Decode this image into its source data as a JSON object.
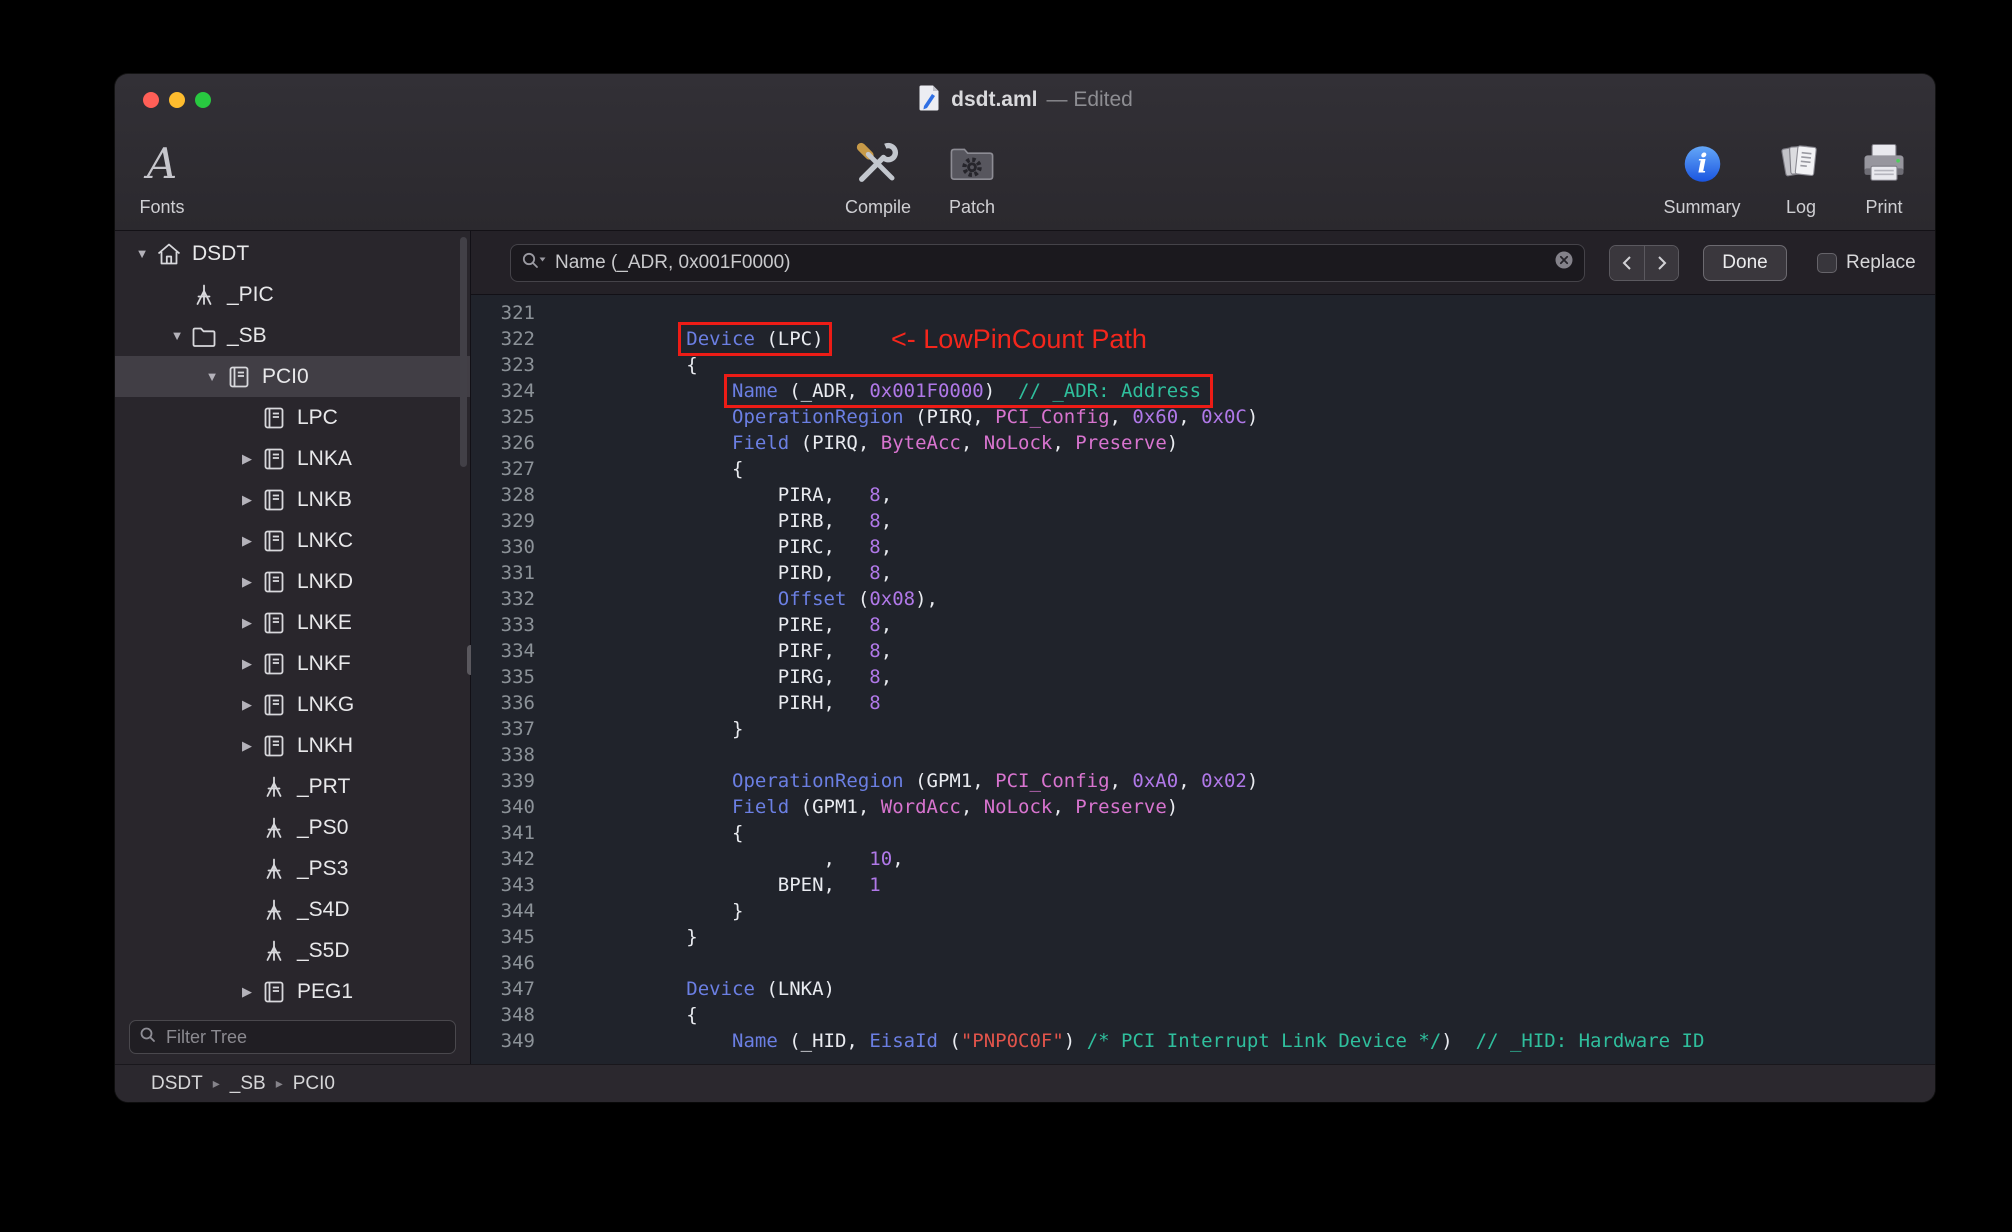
{
  "window": {
    "title_filename": "dsdt.aml",
    "title_status": "— Edited"
  },
  "toolbar": {
    "fonts_label": "Fonts",
    "compile_label": "Compile",
    "patch_label": "Patch",
    "summary_label": "Summary",
    "log_label": "Log",
    "print_label": "Print"
  },
  "sidebar": {
    "filter_placeholder": "Filter Tree",
    "tree": [
      {
        "label": "DSDT",
        "depth": 0,
        "icon": "home",
        "disclosure": "open",
        "selected": false
      },
      {
        "label": "_PIC",
        "depth": 1,
        "icon": "method",
        "disclosure": null,
        "selected": false
      },
      {
        "label": "_SB",
        "depth": 1,
        "icon": "folder",
        "disclosure": "open",
        "selected": false
      },
      {
        "label": "PCI0",
        "depth": 2,
        "icon": "device",
        "disclosure": "open",
        "selected": true
      },
      {
        "label": "LPC",
        "depth": 3,
        "icon": "device",
        "disclosure": null,
        "selected": false
      },
      {
        "label": "LNKA",
        "depth": 3,
        "icon": "device",
        "disclosure": "closed",
        "selected": false
      },
      {
        "label": "LNKB",
        "depth": 3,
        "icon": "device",
        "disclosure": "closed",
        "selected": false
      },
      {
        "label": "LNKC",
        "depth": 3,
        "icon": "device",
        "disclosure": "closed",
        "selected": false
      },
      {
        "label": "LNKD",
        "depth": 3,
        "icon": "device",
        "disclosure": "closed",
        "selected": false
      },
      {
        "label": "LNKE",
        "depth": 3,
        "icon": "device",
        "disclosure": "closed",
        "selected": false
      },
      {
        "label": "LNKF",
        "depth": 3,
        "icon": "device",
        "disclosure": "closed",
        "selected": false
      },
      {
        "label": "LNKG",
        "depth": 3,
        "icon": "device",
        "disclosure": "closed",
        "selected": false
      },
      {
        "label": "LNKH",
        "depth": 3,
        "icon": "device",
        "disclosure": "closed",
        "selected": false
      },
      {
        "label": "_PRT",
        "depth": 3,
        "icon": "method",
        "disclosure": null,
        "selected": false
      },
      {
        "label": "_PS0",
        "depth": 3,
        "icon": "method",
        "disclosure": null,
        "selected": false
      },
      {
        "label": "_PS3",
        "depth": 3,
        "icon": "method",
        "disclosure": null,
        "selected": false
      },
      {
        "label": "_S4D",
        "depth": 3,
        "icon": "method",
        "disclosure": null,
        "selected": false
      },
      {
        "label": "_S5D",
        "depth": 3,
        "icon": "method",
        "disclosure": null,
        "selected": false
      },
      {
        "label": "PEG1",
        "depth": 3,
        "icon": "device",
        "disclosure": "closed",
        "selected": false
      }
    ]
  },
  "search": {
    "query": "Name (_ADR, 0x001F0000)",
    "done_label": "Done",
    "replace_label": "Replace"
  },
  "breadcrumb": [
    "DSDT",
    "_SB",
    "PCI0"
  ],
  "annotation": {
    "arrow_text": "<- LowPinCount Path",
    "highlight_color": "#ed1c16"
  },
  "colors": {
    "syntax_keyword": "#6b7fe3",
    "syntax_number": "#b078e8",
    "syntax_predefined": "#d874cf",
    "syntax_comment": "#2fbf9d",
    "syntax_string": "#e2544b",
    "editor_background": "#20232b",
    "traffic_red": "#ff5f57",
    "traffic_yellow": "#febc2e",
    "traffic_green": "#28c840"
  },
  "editor": {
    "lines": [
      {
        "num": "321",
        "seg": []
      },
      {
        "num": "322",
        "seg": [
          [
            "t",
            "            "
          ],
          [
            "k",
            "Device"
          ],
          [
            "t",
            " (LPC)"
          ]
        ]
      },
      {
        "num": "323",
        "seg": [
          [
            "t",
            "            {"
          ]
        ]
      },
      {
        "num": "324",
        "seg": [
          [
            "t",
            "                "
          ],
          [
            "k",
            "Name"
          ],
          [
            "t",
            " (_ADR, "
          ],
          [
            "n",
            "0x001F0000"
          ],
          [
            "t",
            ")  "
          ],
          [
            "c",
            "// _ADR: Address"
          ]
        ]
      },
      {
        "num": "325",
        "seg": [
          [
            "t",
            "                "
          ],
          [
            "k",
            "OperationRegion"
          ],
          [
            "t",
            " (PIRQ, "
          ],
          [
            "p",
            "PCI_Config"
          ],
          [
            "t",
            ", "
          ],
          [
            "n",
            "0x60"
          ],
          [
            "t",
            ", "
          ],
          [
            "n",
            "0x0C"
          ],
          [
            "t",
            ")"
          ]
        ]
      },
      {
        "num": "326",
        "seg": [
          [
            "t",
            "                "
          ],
          [
            "k",
            "Field"
          ],
          [
            "t",
            " (PIRQ, "
          ],
          [
            "p",
            "ByteAcc"
          ],
          [
            "t",
            ", "
          ],
          [
            "p",
            "NoLock"
          ],
          [
            "t",
            ", "
          ],
          [
            "p",
            "Preserve"
          ],
          [
            "t",
            ")"
          ]
        ]
      },
      {
        "num": "327",
        "seg": [
          [
            "t",
            "                {"
          ]
        ]
      },
      {
        "num": "328",
        "seg": [
          [
            "t",
            "                    PIRA,   "
          ],
          [
            "n",
            "8"
          ],
          [
            "t",
            ","
          ]
        ]
      },
      {
        "num": "329",
        "seg": [
          [
            "t",
            "                    PIRB,   "
          ],
          [
            "n",
            "8"
          ],
          [
            "t",
            ","
          ]
        ]
      },
      {
        "num": "330",
        "seg": [
          [
            "t",
            "                    PIRC,   "
          ],
          [
            "n",
            "8"
          ],
          [
            "t",
            ","
          ]
        ]
      },
      {
        "num": "331",
        "seg": [
          [
            "t",
            "                    PIRD,   "
          ],
          [
            "n",
            "8"
          ],
          [
            "t",
            ","
          ]
        ]
      },
      {
        "num": "332",
        "seg": [
          [
            "t",
            "                    "
          ],
          [
            "k",
            "Offset"
          ],
          [
            "t",
            " ("
          ],
          [
            "n",
            "0x08"
          ],
          [
            "t",
            "),"
          ]
        ]
      },
      {
        "num": "333",
        "seg": [
          [
            "t",
            "                    PIRE,   "
          ],
          [
            "n",
            "8"
          ],
          [
            "t",
            ","
          ]
        ]
      },
      {
        "num": "334",
        "seg": [
          [
            "t",
            "                    PIRF,   "
          ],
          [
            "n",
            "8"
          ],
          [
            "t",
            ","
          ]
        ]
      },
      {
        "num": "335",
        "seg": [
          [
            "t",
            "                    PIRG,   "
          ],
          [
            "n",
            "8"
          ],
          [
            "t",
            ","
          ]
        ]
      },
      {
        "num": "336",
        "seg": [
          [
            "t",
            "                    PIRH,   "
          ],
          [
            "n",
            "8"
          ]
        ]
      },
      {
        "num": "337",
        "seg": [
          [
            "t",
            "                }"
          ]
        ]
      },
      {
        "num": "338",
        "seg": []
      },
      {
        "num": "339",
        "seg": [
          [
            "t",
            "                "
          ],
          [
            "k",
            "OperationRegion"
          ],
          [
            "t",
            " (GPM1, "
          ],
          [
            "p",
            "PCI_Config"
          ],
          [
            "t",
            ", "
          ],
          [
            "n",
            "0xA0"
          ],
          [
            "t",
            ", "
          ],
          [
            "n",
            "0x02"
          ],
          [
            "t",
            ")"
          ]
        ]
      },
      {
        "num": "340",
        "seg": [
          [
            "t",
            "                "
          ],
          [
            "k",
            "Field"
          ],
          [
            "t",
            " (GPM1, "
          ],
          [
            "p",
            "WordAcc"
          ],
          [
            "t",
            ", "
          ],
          [
            "p",
            "NoLock"
          ],
          [
            "t",
            ", "
          ],
          [
            "p",
            "Preserve"
          ],
          [
            "t",
            ")"
          ]
        ]
      },
      {
        "num": "341",
        "seg": [
          [
            "t",
            "                {"
          ]
        ]
      },
      {
        "num": "342",
        "seg": [
          [
            "t",
            "                        ,   "
          ],
          [
            "n",
            "10"
          ],
          [
            "t",
            ","
          ]
        ]
      },
      {
        "num": "343",
        "seg": [
          [
            "t",
            "                    BPEN,   "
          ],
          [
            "n",
            "1"
          ]
        ]
      },
      {
        "num": "344",
        "seg": [
          [
            "t",
            "                }"
          ]
        ]
      },
      {
        "num": "345",
        "seg": [
          [
            "t",
            "            }"
          ]
        ]
      },
      {
        "num": "346",
        "seg": []
      },
      {
        "num": "347",
        "seg": [
          [
            "t",
            "            "
          ],
          [
            "k",
            "Device"
          ],
          [
            "t",
            " (LNKA)"
          ]
        ]
      },
      {
        "num": "348",
        "seg": [
          [
            "t",
            "            {"
          ]
        ]
      },
      {
        "num": "349",
        "seg": [
          [
            "t",
            "                "
          ],
          [
            "k",
            "Name"
          ],
          [
            "t",
            " (_HID, "
          ],
          [
            "k",
            "EisaId"
          ],
          [
            "t",
            " ("
          ],
          [
            "s",
            "\"PNP0C0F\""
          ],
          [
            "t",
            ") "
          ],
          [
            "c",
            "/* PCI Interrupt Link Device */"
          ],
          [
            "t",
            ")  "
          ],
          [
            "c",
            "// _HID: Hardware ID"
          ]
        ]
      }
    ]
  }
}
